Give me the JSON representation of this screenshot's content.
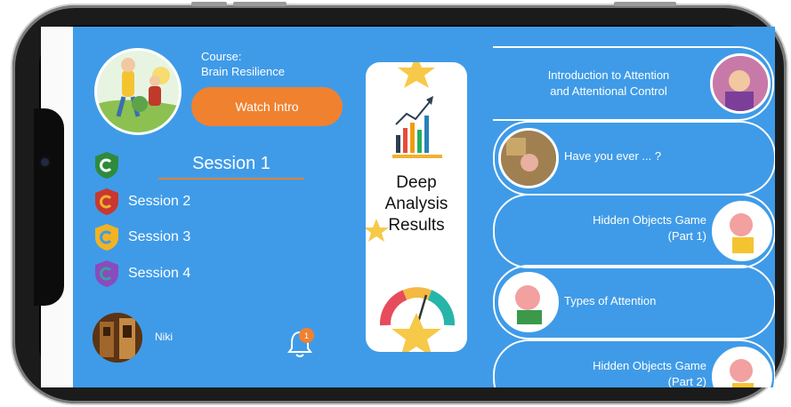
{
  "course": {
    "label": "Course:",
    "name": "Brain Resilience"
  },
  "watch_intro": "Watch Intro",
  "current_session": "Session 1",
  "sessions": [
    {
      "label": "Session 2",
      "color": "#c9382f"
    },
    {
      "label": "Session 3",
      "color": "#f2b322"
    },
    {
      "label": "Session 4",
      "color": "#8a4bbd"
    }
  ],
  "session1_shield_color": "#2e8b3b",
  "user": {
    "name": "Niki"
  },
  "notifications": {
    "count": "1"
  },
  "analysis_card": {
    "line1": "Deep",
    "line2": "Analysis",
    "line3": "Results"
  },
  "lessons": [
    {
      "title_1": "Introduction to Attention",
      "title_2": "and Attentional Control"
    },
    {
      "title_1": "Have you ever ... ?",
      "title_2": ""
    },
    {
      "title_1": "Hidden Objects Game",
      "title_2": "(Part 1)"
    },
    {
      "title_1": "Types of Attention",
      "title_2": ""
    },
    {
      "title_1": "Hidden Objects Game",
      "title_2": "(Part 2)"
    }
  ],
  "colors": {
    "screen_bg": "#3f9be8",
    "accent": "#f0812f"
  }
}
